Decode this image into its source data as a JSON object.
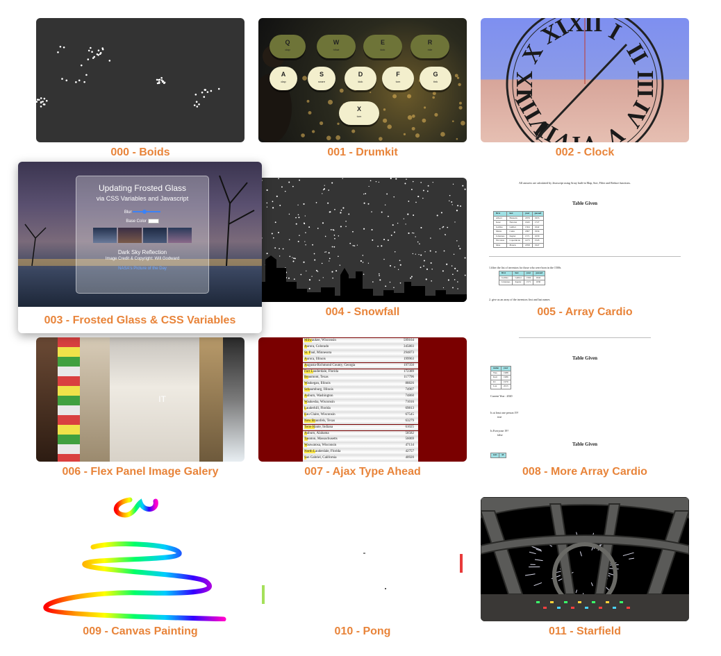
{
  "cards": [
    {
      "title": "000 - Boids"
    },
    {
      "title": "001 - Drumkit"
    },
    {
      "title": "002 - Clock"
    },
    {
      "title": "003 - Frosted Glass & CSS Variables"
    },
    {
      "title": "004 - Snowfall"
    },
    {
      "title": "005 - Array Cardio"
    },
    {
      "title": "006 - Flex Panel Image Galery"
    },
    {
      "title": "007 - Ajax Type Ahead"
    },
    {
      "title": "008 - More Array Cardio"
    },
    {
      "title": "009 - Canvas Painting"
    },
    {
      "title": "010 - Pong"
    },
    {
      "title": "011 - Starfield"
    }
  ],
  "drumkit": {
    "keys": [
      {
        "k": "Q",
        "s": "clap"
      },
      {
        "k": "W",
        "s": "hihat"
      },
      {
        "k": "E",
        "s": "kick"
      },
      {
        "k": "R",
        "s": "ride"
      },
      {
        "k": "A",
        "s": "clap"
      },
      {
        "k": "S",
        "s": "snare"
      },
      {
        "k": "D",
        "s": "kick"
      },
      {
        "k": "F",
        "s": "tom"
      },
      {
        "k": "G",
        "s": "tink"
      },
      {
        "k": "X",
        "s": "tom"
      }
    ]
  },
  "clock": {
    "numerals": [
      "XII",
      "I",
      "II",
      "III",
      "IV",
      "V",
      "VI",
      "VII",
      "VIII",
      "IX",
      "X",
      "XI"
    ]
  },
  "frosted": {
    "heading": "Updating Frosted Glass",
    "subheading": "via CSS Variables and Javascript",
    "blur_label": "Blur",
    "color_label": "Base Color",
    "caption_title": "Dark Sky Reflection",
    "caption_credit": "Image Credit & Copyright: Will Godward",
    "link": "NASA's Picture of the Day"
  },
  "array_cardio": {
    "intro": "All answers are calculated by Javascript using Array built-in Map, Sort, Filter and Reduce functions.",
    "table_title": "Table Given",
    "headers": [
      "first",
      "last",
      "year",
      "passed"
    ],
    "rows": [
      [
        "Albert",
        "Einstein",
        "1879",
        "1955"
      ],
      [
        "Isaac",
        "Newton",
        "1643",
        "1727"
      ],
      [
        "Galileo",
        "Galilei",
        "1564",
        "1642"
      ],
      [
        "Marie",
        "Curie",
        "1867",
        "1934"
      ],
      [
        "Johannes",
        "Kepler",
        "1571",
        "1630"
      ],
      [
        "Nicolaus",
        "Copernicus",
        "1473",
        "1543"
      ],
      [
        "Max",
        "Planck",
        "1858",
        "1947"
      ]
    ],
    "q1": "1.filter the list of inventors for those who were born in the 1500s",
    "q1_rows": [
      [
        "Galileo",
        "Galilei",
        "1564",
        "1642"
      ],
      [
        "Johannes",
        "Kepler",
        "1571",
        "1630"
      ]
    ],
    "q2": "2. give us an array of the inventors first and last names"
  },
  "more_cardio": {
    "table_title": "Table Given",
    "headers": [
      "name",
      "year"
    ],
    "rows": [
      [
        "Wes",
        "1988"
      ],
      [
        "Kait",
        "1986"
      ],
      [
        "Irv",
        "1970"
      ],
      [
        "Lux",
        "2015"
      ]
    ],
    "current_year": "Current Year : 2020",
    "q1": "Is at least one person 19?",
    "a1": "true",
    "q2": "Is Everyone 19?",
    "a2": "false",
    "table2_title": "Table Given",
    "headers2": [
      "text",
      "id"
    ]
  },
  "typeahead": {
    "rows": [
      {
        "h": "Milw",
        "r": "aukee, Wisconsin",
        "p": "599164"
      },
      {
        "h": "A",
        "r": "urora, Colorado",
        "p": "345803"
      },
      {
        "h": "St. P",
        "r": "aul, Minnesota",
        "p": "294873"
      },
      {
        "h": "A",
        "r": "urora, Illinois",
        "p": "199963"
      },
      {
        "h": "A",
        "r": "ugusta-Richmond County, Georgia",
        "p": "197350"
      },
      {
        "h": "Fort L",
        "r": "auderdale, Florida",
        "p": "172389"
      },
      {
        "h": "Be",
        "r": "aumont, Texas",
        "p": "117796"
      },
      {
        "h": "W",
        "r": "aukegan, Illinois",
        "p": "88826"
      },
      {
        "h": "Sch",
        "r": "aumburg, Illinois",
        "p": "74907"
      },
      {
        "h": "A",
        "r": "uburn, Washington",
        "p": "74860"
      },
      {
        "h": "W",
        "r": "aukesha, Wisconsin",
        "p": "71016"
      },
      {
        "h": "L",
        "r": "auderhill, Florida",
        "p": "69813"
      },
      {
        "h": "E",
        "r": "au Claire, Wisconsin",
        "p": "67545"
      },
      {
        "h": "New Br",
        "r": "aunfels, Texas",
        "p": "63279"
      },
      {
        "h": "Terre H",
        "r": "aute, Indiana",
        "p": "61025"
      },
      {
        "h": "A",
        "r": "uburn, Alabama",
        "p": "58582"
      },
      {
        "h": "Ta",
        "r": "unton, Massachusetts",
        "p": "56069"
      },
      {
        "h": "W",
        "r": "auwatosa, Wisconsin",
        "p": "47134"
      },
      {
        "h": "North L",
        "r": "auderdale, Florida",
        "p": "42757"
      },
      {
        "h": "S",
        "r": "an Gabriel, California",
        "p": "40920"
      }
    ]
  }
}
